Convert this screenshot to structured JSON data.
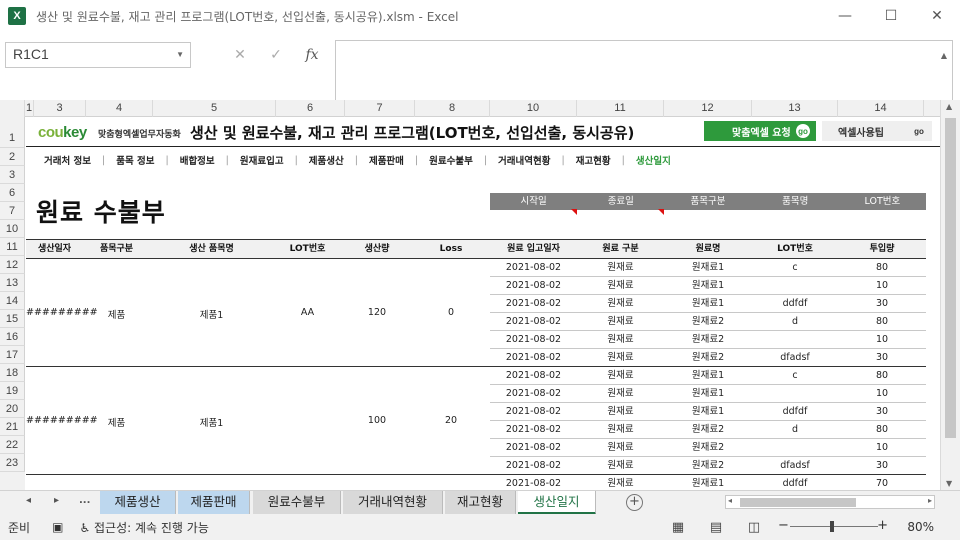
{
  "window": {
    "title": "생산 및 원료수불, 재고 관리 프로그램(LOT번호, 선입선출, 동시공유).xlsm - Excel",
    "logo_letter": "X",
    "minimize": "—",
    "maximize": "☐",
    "close": "✕"
  },
  "formula_bar": {
    "name_box": "R1C1",
    "cancel": "✕",
    "enter": "✓",
    "fx": "fx",
    "value": ""
  },
  "columns": [
    "1",
    "3",
    "4",
    "5",
    "6",
    "7",
    "8",
    "10",
    "11",
    "12",
    "13",
    "14"
  ],
  "rows": [
    "1",
    "2",
    "3",
    "6",
    "7",
    "10",
    "11",
    "12",
    "13",
    "14",
    "15",
    "16",
    "17",
    "18",
    "19",
    "20",
    "21",
    "22",
    "23"
  ],
  "banner": {
    "logo_a": "cou",
    "logo_b": "key",
    "logo_sub": "맞춤형엑셀업무자동화",
    "title": "생산 및 원료수불, 재고 관리 프로그램(LOT번호, 선입선출, 동시공유)",
    "btn_request": "맞춤엑셀 요청",
    "btn_tips": "엑셀사용팁",
    "go": "go"
  },
  "nav": [
    "거래처 정보",
    "품목 정보",
    "배합정보",
    "원재료입고",
    "제품생산",
    "제품판매",
    "원료수불부",
    "거래내역현황",
    "재고현황",
    "생산일지"
  ],
  "page": {
    "heading": "원료 수불부"
  },
  "filter_headers": [
    "시작일",
    "종료일",
    "품목구분",
    "품목명",
    "LOT번호"
  ],
  "table_headers": [
    "생산일자",
    "품목구분",
    "생산 품목명",
    "LOT번호",
    "생산량",
    "Loss",
    "원료 입고일자",
    "원료 구분",
    "원료명",
    "LOT번호",
    "투입량"
  ],
  "groups": [
    {
      "date": "#########",
      "type": "제품",
      "product": "제품1",
      "lot": "AA",
      "qty": "120",
      "loss": "0",
      "rows": [
        {
          "in_date": "2021-08-02",
          "kind": "원재료",
          "name": "원재료1",
          "lot": "c",
          "amount": "80"
        },
        {
          "in_date": "2021-08-02",
          "kind": "원재료",
          "name": "원재료1",
          "lot": "",
          "amount": "10"
        },
        {
          "in_date": "2021-08-02",
          "kind": "원재료",
          "name": "원재료1",
          "lot": "ddfdf",
          "amount": "30"
        },
        {
          "in_date": "2021-08-02",
          "kind": "원재료",
          "name": "원재료2",
          "lot": "d",
          "amount": "80"
        },
        {
          "in_date": "2021-08-02",
          "kind": "원재료",
          "name": "원재료2",
          "lot": "",
          "amount": "10"
        },
        {
          "in_date": "2021-08-02",
          "kind": "원재료",
          "name": "원재료2",
          "lot": "dfadsf",
          "amount": "30"
        }
      ]
    },
    {
      "date": "#########",
      "type": "제품",
      "product": "제품1",
      "lot": "",
      "qty": "100",
      "loss": "20",
      "rows": [
        {
          "in_date": "2021-08-02",
          "kind": "원재료",
          "name": "원재료1",
          "lot": "c",
          "amount": "80"
        },
        {
          "in_date": "2021-08-02",
          "kind": "원재료",
          "name": "원재료1",
          "lot": "",
          "amount": "10"
        },
        {
          "in_date": "2021-08-02",
          "kind": "원재료",
          "name": "원재료1",
          "lot": "ddfdf",
          "amount": "30"
        },
        {
          "in_date": "2021-08-02",
          "kind": "원재료",
          "name": "원재료2",
          "lot": "d",
          "amount": "80"
        },
        {
          "in_date": "2021-08-02",
          "kind": "원재료",
          "name": "원재료2",
          "lot": "",
          "amount": "10"
        },
        {
          "in_date": "2021-08-02",
          "kind": "원재료",
          "name": "원재료2",
          "lot": "dfadsf",
          "amount": "30"
        }
      ]
    },
    {
      "date": "",
      "type": "",
      "product": "",
      "lot": "",
      "qty": "",
      "loss": "",
      "rows": [
        {
          "in_date": "2021-08-02",
          "kind": "원재료",
          "name": "원재료1",
          "lot": "ddfdf",
          "amount": "70"
        }
      ]
    }
  ],
  "tabs": {
    "prev": "◂",
    "next": "▸",
    "more": "...",
    "items": [
      "제품생산",
      "제품판매",
      "원료수불부",
      "거래내역현황",
      "재고현황",
      "생산일지"
    ],
    "add": "+"
  },
  "status": {
    "ready": "준비",
    "accessibility": "접근성: 계속 진행 가능",
    "zoom": "80%",
    "zoom_minus": "−",
    "zoom_plus": "+"
  },
  "colors": {
    "accent_green": "#2e9a3c",
    "excel_green": "#217346",
    "tab_blue": "#bdd7ee",
    "filter_gray": "#7f7f7f"
  }
}
